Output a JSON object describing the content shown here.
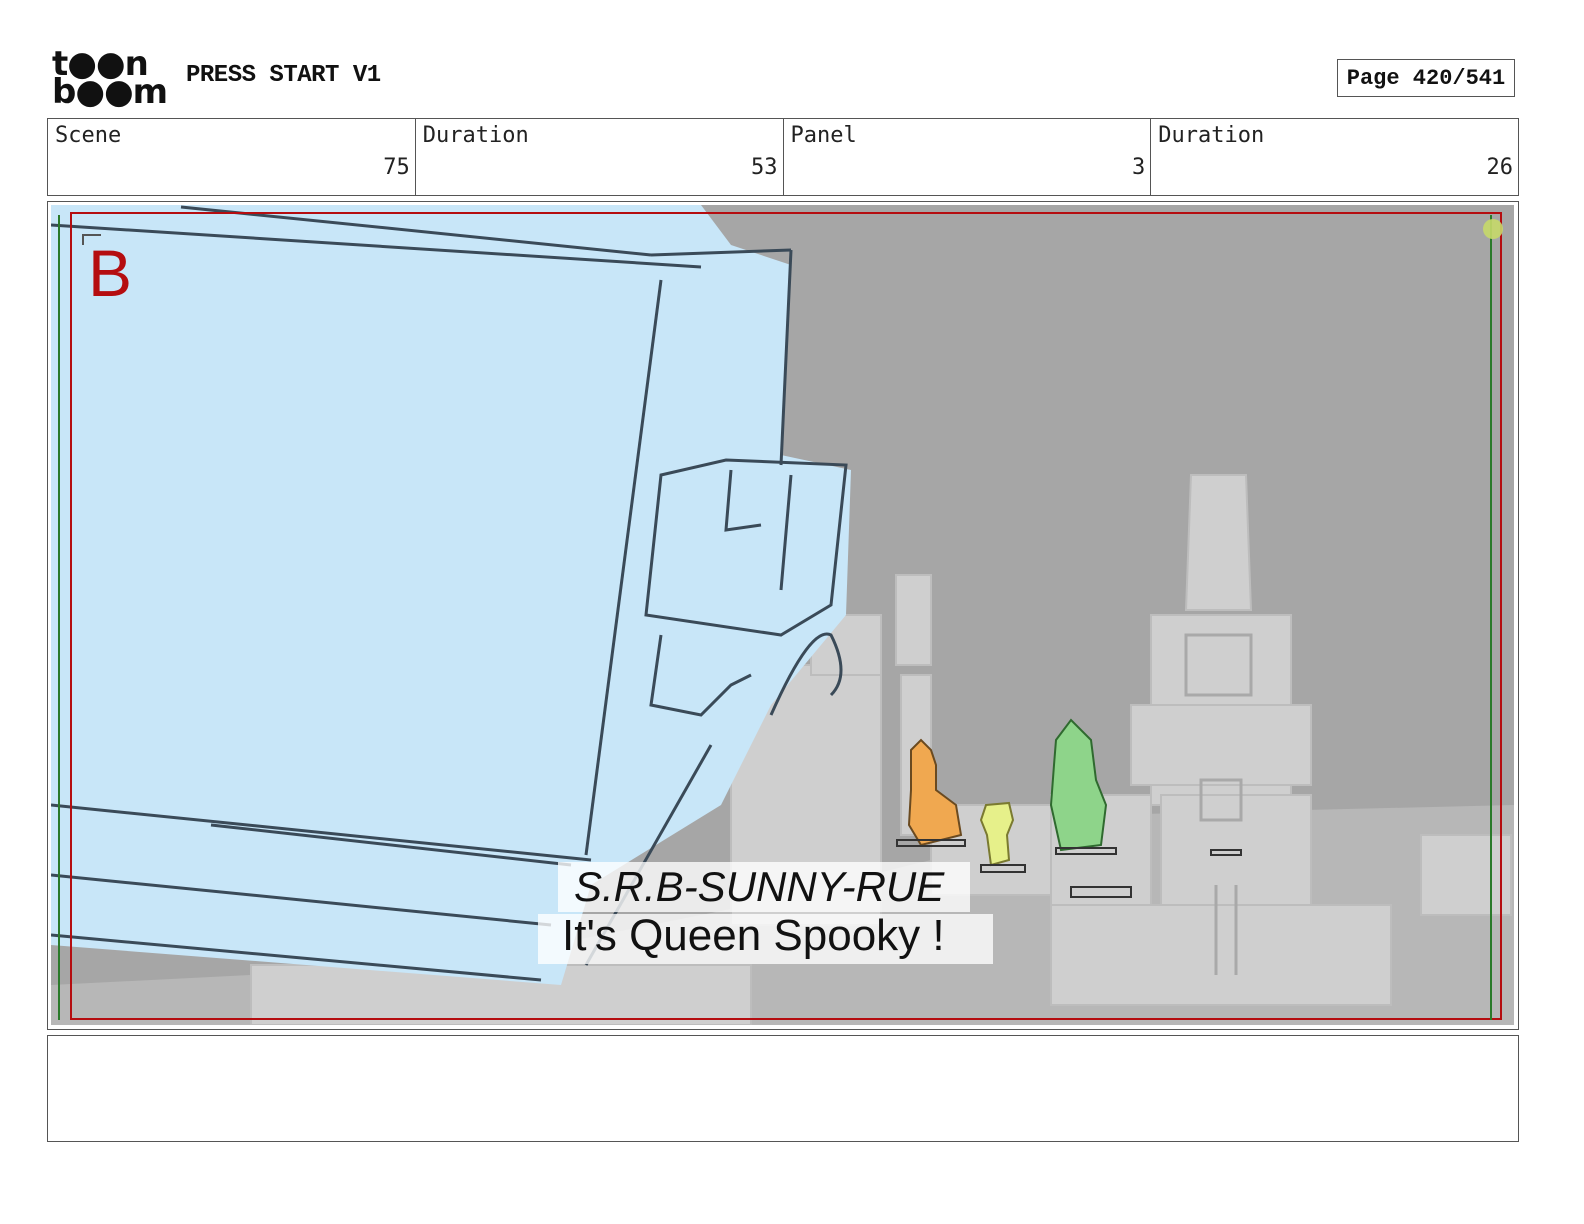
{
  "header": {
    "logo_line1": "t●●n",
    "logo_line2": "b●●m",
    "project_title": "PRESS START V1",
    "page_label": "Page 420/541"
  },
  "info": [
    {
      "label": "Scene",
      "value": "75"
    },
    {
      "label": "Duration",
      "value": "53"
    },
    {
      "label": "Panel",
      "value": "3"
    },
    {
      "label": "Duration",
      "value": "26"
    }
  ],
  "panel": {
    "marker": "B",
    "caption_speaker": "S.R.B-SUNNY-RUE",
    "caption_line": "It's Queen Spooky !",
    "colors": {
      "safe_frame_red": "#b50d10",
      "safe_frame_green": "#2a7a2a",
      "character_blue": "#c8e6f8",
      "background_gray": "#a4a4a4",
      "orange_figure": "#f0a850",
      "yellow_figure": "#e6f08a",
      "green_figure": "#8ed48a"
    }
  },
  "notes": {
    "text": ""
  }
}
